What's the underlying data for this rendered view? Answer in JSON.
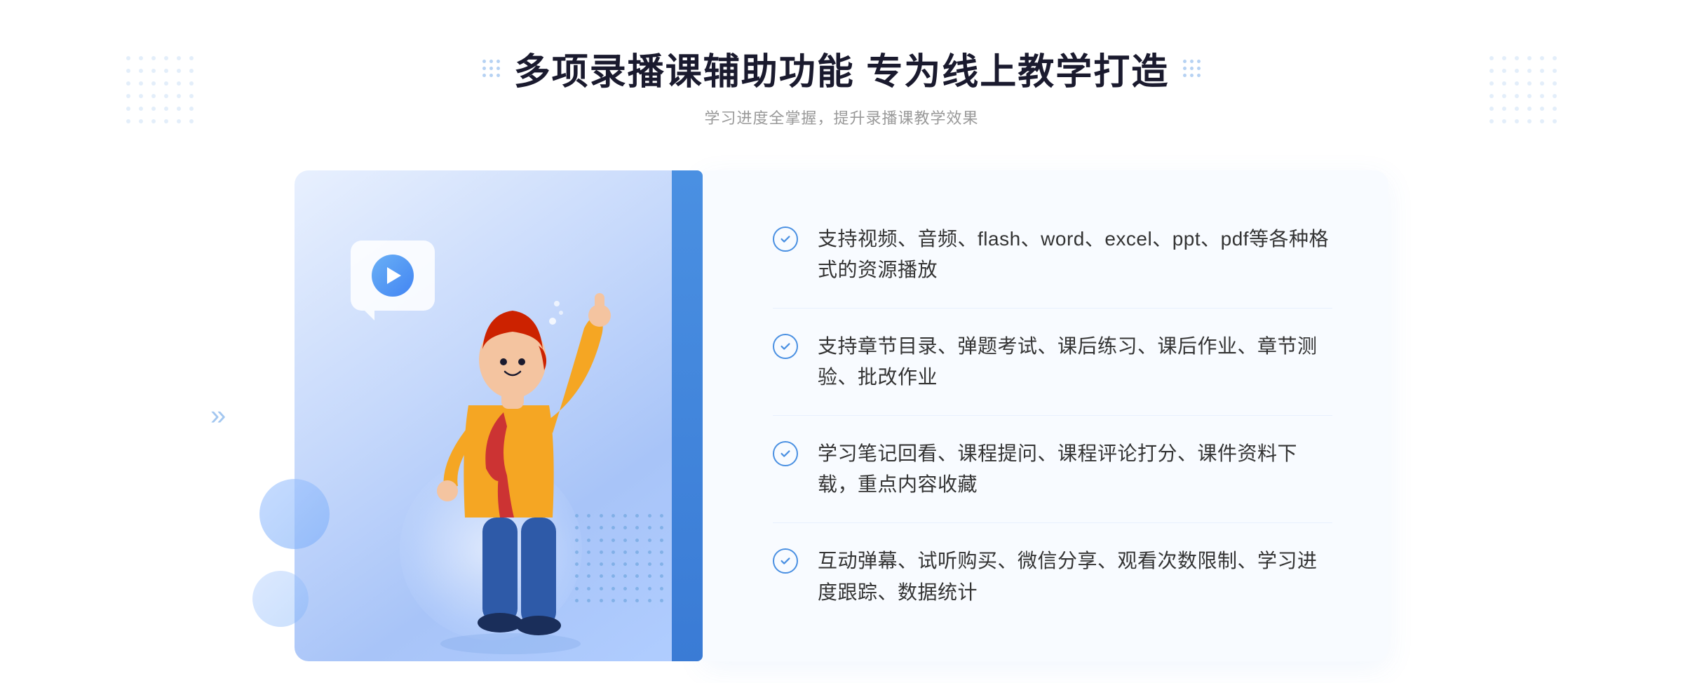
{
  "header": {
    "title": "多项录播课辅助功能 专为线上教学打造",
    "subtitle": "学习进度全掌握，提升录播课教学效果"
  },
  "features": [
    {
      "id": 1,
      "text": "支持视频、音频、flash、word、excel、ppt、pdf等各种格式的资源播放"
    },
    {
      "id": 2,
      "text": "支持章节目录、弹题考试、课后练习、课后作业、章节测验、批改作业"
    },
    {
      "id": 3,
      "text": "学习笔记回看、课程提问、课程评论打分、课件资料下载，重点内容收藏"
    },
    {
      "id": 4,
      "text": "互动弹幕、试听购买、微信分享、观看次数限制、学习进度跟踪、数据统计"
    }
  ],
  "icons": {
    "play": "▶",
    "check": "✓",
    "chevron": "»"
  },
  "colors": {
    "primary": "#4a90e2",
    "title": "#1a1a2e",
    "subtitle": "#999999",
    "text": "#333333",
    "bg_light": "#f8fbff",
    "illustration_gradient_start": "#e8f0fe",
    "illustration_gradient_end": "#a8c4f8"
  }
}
